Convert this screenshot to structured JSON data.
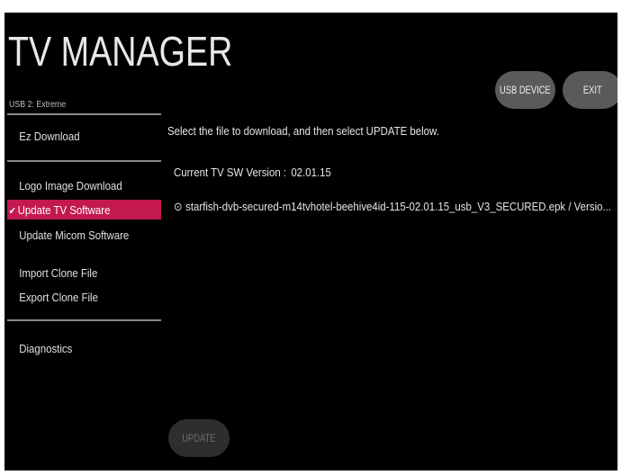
{
  "header": {
    "title": "TV MANAGER",
    "device_label": "USB 2: Extreme",
    "usb_device_label": "USB DEVICE",
    "exit_label": "EXIT"
  },
  "sidebar": {
    "items": [
      {
        "label": "Ez Download",
        "selected": false
      },
      {
        "label": "Logo Image Download",
        "selected": false
      },
      {
        "label": "Update TV Software",
        "selected": true
      },
      {
        "label": "Update Micom Software",
        "selected": false
      },
      {
        "label": "Import Clone File",
        "selected": false
      },
      {
        "label": "Export Clone File",
        "selected": false
      },
      {
        "label": "Diagnostics",
        "selected": false
      }
    ],
    "check_glyph": "✔"
  },
  "main": {
    "instruction": "Select the file to download, and then select UPDATE below.",
    "current_version_label": "Current TV SW Version :",
    "current_version_value": "02.01.15",
    "file_glyph": "⊙",
    "file_entry": "starfish-dvb-secured-m14tvhotel-beehive4id-115-02.01.15_usb_V3_SECURED.epk / Versio...",
    "update_label": "UPDATE"
  },
  "colors": {
    "background": "#000000",
    "selected": "#c3194f",
    "button": "#5a5a5a",
    "button_disabled": "#2e2e2e"
  }
}
